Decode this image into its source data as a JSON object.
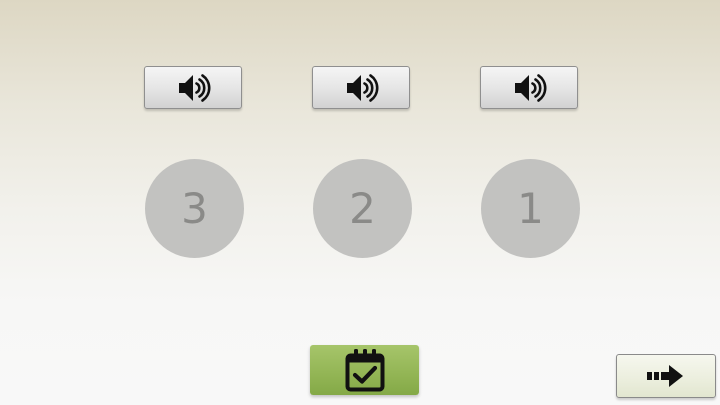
{
  "sound_buttons": [
    {
      "icon": "speaker-icon"
    },
    {
      "icon": "speaker-icon"
    },
    {
      "icon": "speaker-icon"
    }
  ],
  "number_options": [
    {
      "label": "3"
    },
    {
      "label": "2"
    },
    {
      "label": "1"
    }
  ],
  "check_button": {
    "icon": "calendar-check-icon",
    "color": "#94b656"
  },
  "next_button": {
    "icon": "arrow-right-icon"
  },
  "colors": {
    "circle": "#c2c2c0",
    "circle_text": "#8a8a88",
    "check_green": "#94b656"
  }
}
